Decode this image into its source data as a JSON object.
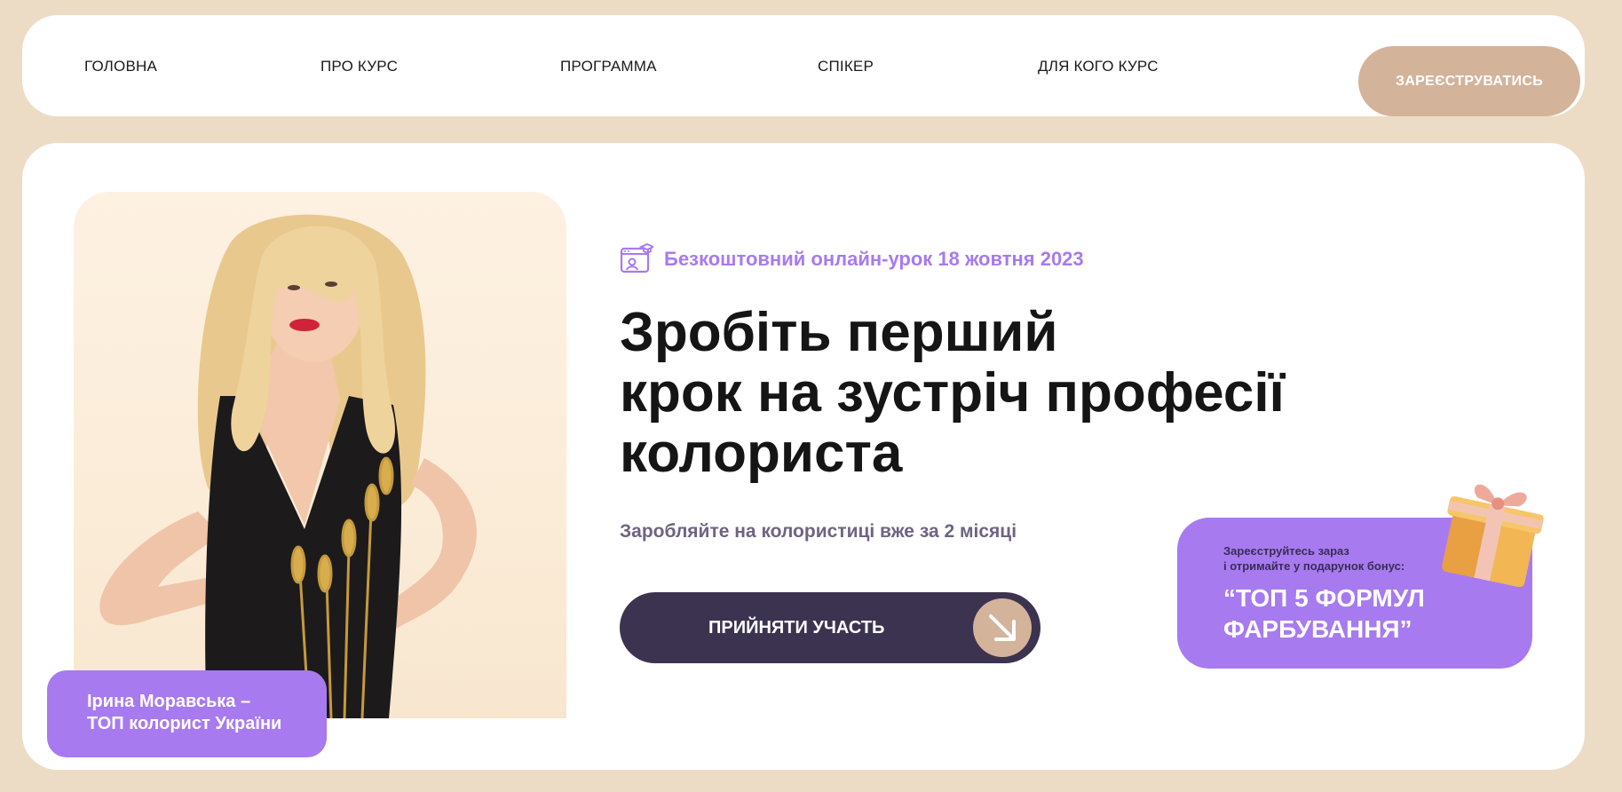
{
  "nav": {
    "items": [
      {
        "label": "ГОЛОВНА"
      },
      {
        "label": "ПРО КУРС"
      },
      {
        "label": "ПРОГРАММА"
      },
      {
        "label": "СПІКЕР"
      },
      {
        "label": "ДЛЯ КОГО КУРС"
      }
    ],
    "register_label": "ЗАРЕЄСТРУВАТИСЬ"
  },
  "hero": {
    "promo": "Безкоштовний онлайн-урок 18 жовтня 2023",
    "promo_icon": "online-course-icon",
    "headline_lines": [
      "Зробіть перший",
      "крок на зустріч професії",
      "колориста"
    ],
    "subline": "Заробляйте на колористиці вже за 2 місяці",
    "cta_label": "ПРИЙНЯТИ УЧАСТЬ",
    "cta_icon": "arrow-down-right-icon"
  },
  "speaker": {
    "line1": "Ірина Моравська –",
    "line2": "ТОП колорист України"
  },
  "bonus": {
    "line1": "Зареєструйтесь зараз",
    "line2": "і отримайте у подарунок бонус:",
    "title_line1": "“ТОП 5 ФОРМУЛ",
    "title_line2": "ФАРБУВАННЯ”",
    "icon": "gift-box-icon"
  },
  "colors": {
    "page_bg": "#eddcc5",
    "accent_purple": "#a77af0",
    "beige_button": "#d4b39b",
    "dark_button": "#3c3350"
  }
}
